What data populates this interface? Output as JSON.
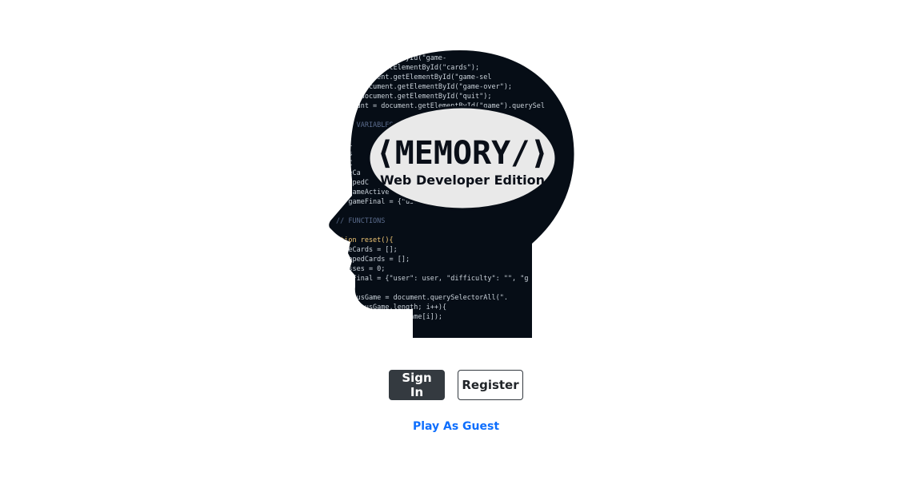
{
  "logo": {
    "title": "⟨MEMORY/⟩",
    "subtitle": "Web Developer Edition",
    "code_lines": [
      "   ument.getElementById(\"game-",
      "   = document.getElementById(\"cards\");",
      "   rt = document.getElementById(\"game-sel",
      "   ver = document.getElementById(\"game-over\");",
      "   Btn = document.getElementById(\"quit\");",
      "   essCount = document.getElementById(\"game\").querySel",
      "",
      "  GAME VARIABLES                               HTML;",
      "  er",
      "  iffi",
      "  uess",
      "  tmlC",
      "  gameCa",
      "  flippedC",
      "et gameActive",
      "et gameFinal = {\"user\"                  \"guesses\":",
      "",
      "// FUNCTIONS",
      "",
      "ction reset(){",
      "  gameCards = [];",
      "  flippedCards = [];",
      "  guesses = 0;",
      "  gameFinal = {\"user\": user, \"difficulty\": \"\", \"g",
      "",
      "  reviousGame = document.querySelectorAll(\".",
      "       (previousGame.length; i++){",
      "       oveChild(previousGame[i]);"
    ]
  },
  "actions": {
    "sign_in": "Sign In",
    "register": "Register",
    "guest": "Play As Guest"
  },
  "colors": {
    "head": "#060d16",
    "badge": "#e9e9e9",
    "primary_dark": "#343a40",
    "link": "#0d6efd"
  }
}
